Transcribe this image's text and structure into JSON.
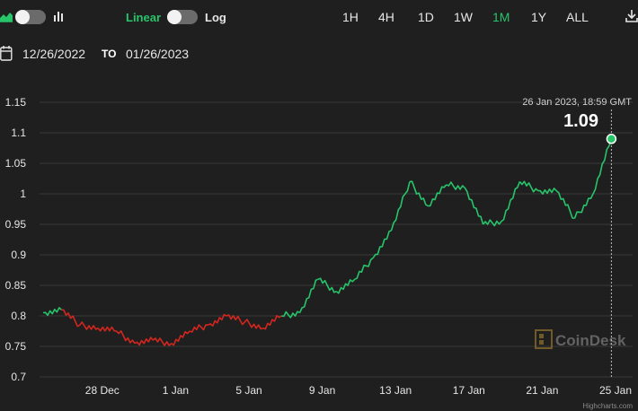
{
  "toolbar": {
    "area_chart_icon": "area-chart-icon",
    "bar_chart_icon": "bar-chart-icon",
    "scale_linear": "Linear",
    "scale_log": "Log",
    "ranges": [
      "1H",
      "4H",
      "1D",
      "1W",
      "1M",
      "1Y",
      "ALL"
    ],
    "active_range": "1M",
    "download_icon": "download-icon"
  },
  "date_range": {
    "calendar_icon": "calendar-icon",
    "from": "12/26/2022",
    "to_label": "TO",
    "to": "01/26/2023"
  },
  "tooltip": {
    "date": "26 Jan 2023, 18:59 GMT",
    "value": "1.09"
  },
  "watermark": "CoinDesk",
  "credit": "Highcharts.com",
  "colors": {
    "up": "#27c46a",
    "down": "#d3261f",
    "background": "#1f1f1f",
    "grid": "#3a3a3a"
  },
  "chart_data": {
    "type": "line",
    "title": "",
    "xlabel": "",
    "ylabel": "",
    "ylim": [
      0.7,
      1.15
    ],
    "yticks": [
      "0.7",
      "0.75",
      "0.8",
      "0.85",
      "0.9",
      "0.95",
      "1",
      "1.05",
      "1.1",
      "1.15"
    ],
    "xticks": [
      {
        "day": 2,
        "label": "28 Dec"
      },
      {
        "day": 6,
        "label": "1 Jan"
      },
      {
        "day": 10,
        "label": "5 Jan"
      },
      {
        "day": 14,
        "label": "9 Jan"
      },
      {
        "day": 18,
        "label": "13 Jan"
      },
      {
        "day": 22,
        "label": "17 Jan"
      },
      {
        "day": 26,
        "label": "21 Jan"
      },
      {
        "day": 30,
        "label": "25 Jan"
      }
    ],
    "grid": true,
    "series": [
      {
        "x": [
          "26 Dec",
          "27 Dec",
          "28 Dec",
          "29 Dec",
          "30 Dec",
          "31 Dec",
          "1 Jan",
          "2 Jan",
          "3 Jan",
          "4 Jan",
          "5 Jan",
          "6 Jan",
          "7 Jan",
          "8 Jan",
          "9 Jan",
          "10 Jan",
          "11 Jan",
          "12 Jan",
          "13 Jan",
          "14 Jan",
          "15 Jan",
          "16 Jan",
          "17 Jan",
          "18 Jan",
          "19 Jan",
          "20 Jan",
          "21 Jan",
          "22 Jan",
          "23 Jan",
          "24 Jan",
          "25 Jan",
          "26 Jan"
        ],
        "day": [
          0,
          1,
          2,
          3,
          4,
          5,
          6,
          7,
          8,
          9,
          10,
          11,
          12,
          13,
          14,
          15,
          16,
          17,
          18,
          19,
          20,
          21,
          22,
          23,
          24,
          25,
          26,
          27,
          28,
          29,
          30,
          31
        ],
        "values": [
          0.805,
          0.81,
          0.785,
          0.78,
          0.775,
          0.755,
          0.76,
          0.755,
          0.775,
          0.785,
          0.8,
          0.79,
          0.78,
          0.8,
          0.805,
          0.86,
          0.84,
          0.86,
          0.895,
          0.94,
          1.02,
          0.98,
          1.015,
          1.01,
          0.95,
          0.955,
          1.02,
          1.005,
          1.005,
          0.96,
          1.0,
          1.09
        ]
      }
    ]
  }
}
